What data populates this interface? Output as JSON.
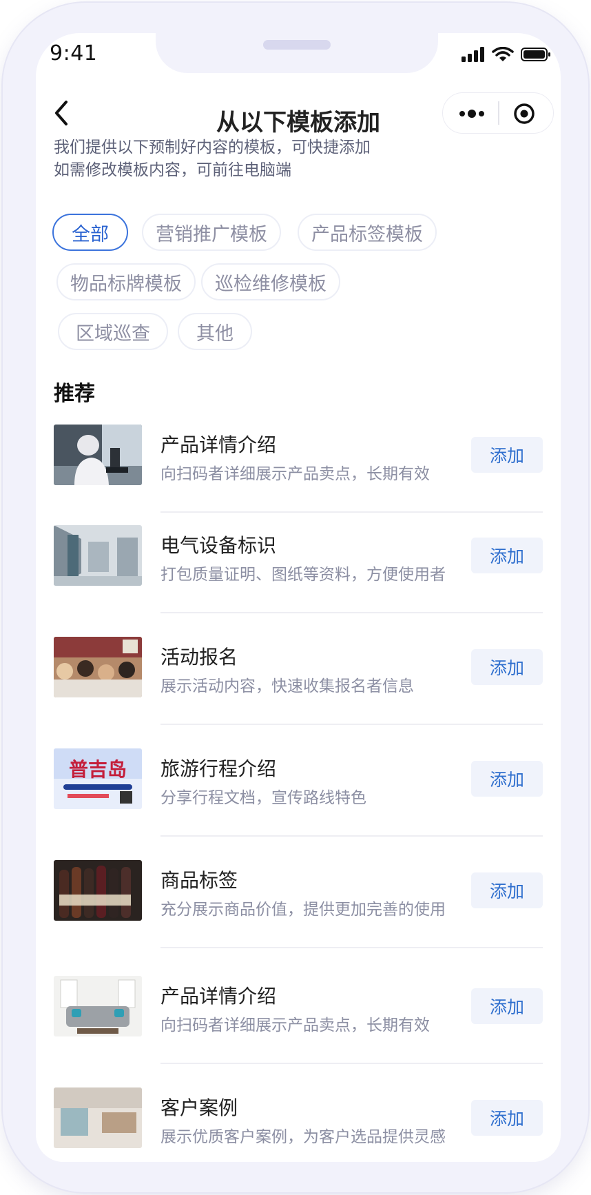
{
  "status": {
    "time": "9:41"
  },
  "nav": {
    "title": "从以下模板添加"
  },
  "intro": {
    "line1": "我们提供以下预制好内容的模板，可快捷添加",
    "line2": "如需修改模板内容，可前往电脑端"
  },
  "tags": [
    "全部",
    "营销推广模板",
    "产品标签模板",
    "物品标牌模板",
    "巡检维修模板",
    "区域巡查",
    "其他"
  ],
  "active_tag": "全部",
  "section": {
    "title": "推荐"
  },
  "add_label": "添加",
  "items": [
    {
      "title": "产品详情介绍",
      "desc": "向扫码者详细展示产品卖点，长期有效",
      "thumb": "lab-scientist-photo"
    },
    {
      "title": "电气设备标识",
      "desc": "打包质量证明、图纸等资料，方便使用者",
      "thumb": "electrical-room-photo"
    },
    {
      "title": "活动报名",
      "desc": "展示活动内容，快速收集报名者信息",
      "thumb": "classroom-children-photo"
    },
    {
      "title": "旅游行程介绍",
      "desc": "分享行程文档，宣传路线特色",
      "thumb": "travel-poster-image"
    },
    {
      "title": "商品标签",
      "desc": "充分展示商品价值，提供更加完善的使用",
      "thumb": "wine-bottles-photo"
    },
    {
      "title": "产品详情介绍",
      "desc": "向扫码者详细展示产品卖点，长期有效",
      "thumb": "living-room-sofa-photo"
    },
    {
      "title": "客户案例",
      "desc": "展示优质客户案例，为客户选品提供灵感",
      "thumb": "interior-design-photo"
    }
  ],
  "colors": {
    "accent": "#2c64d1",
    "button_bg": "#f0f3fb",
    "button_text": "#2f6fce",
    "desc_text": "#8c8fa3"
  }
}
